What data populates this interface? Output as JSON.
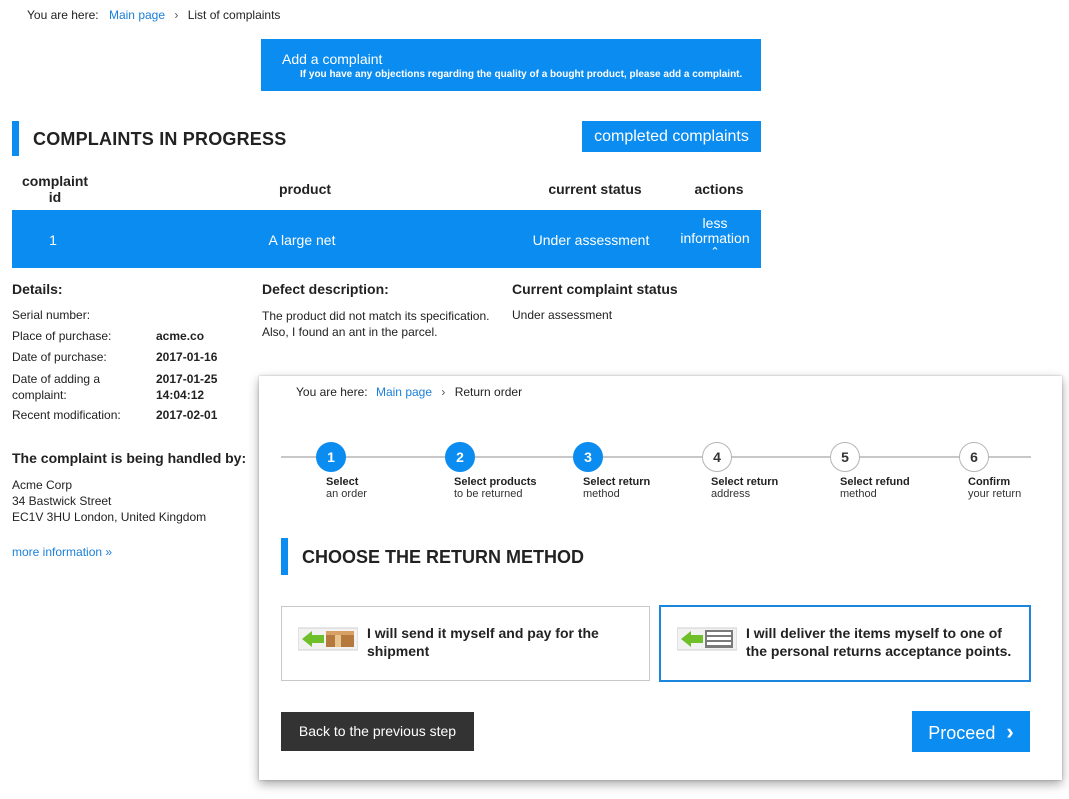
{
  "background": {
    "breadcrumb": {
      "prefix": "You are here:",
      "home": "Main page",
      "separator": "›",
      "current": "List of complaints"
    },
    "banner": {
      "title": "Add a complaint",
      "subtitle": "If you have any objections regarding the quality of a bought product, please add a complaint."
    },
    "section_title": "COMPLAINTS IN PROGRESS",
    "completed_button": "completed complaints",
    "table": {
      "headers": {
        "id_line1": "complaint",
        "id_line2": "id",
        "product": "product",
        "status": "current status",
        "actions": "actions"
      },
      "row": {
        "id": "1",
        "product": "A large net",
        "status": "Under assessment",
        "action_line1": "less",
        "action_line2": "information",
        "action_icon": "⌃"
      }
    },
    "details": {
      "heading": "Details:",
      "serial_label": "Serial number:",
      "place_label": "Place of purchase:",
      "place_value": "acme.co",
      "date_label": "Date of purchase:",
      "date_value": "2017-01-16",
      "added_label_line1": "Date of adding a",
      "added_label_line2": "complaint:",
      "added_value_line1": "2017-01-25",
      "added_value_line2": "14:04:12",
      "modified_label": "Recent modification:",
      "modified_value": "2017-02-01"
    },
    "defect": {
      "heading": "Defect description:",
      "line1": "The product did not match its specification.",
      "line2": "Also, I found an ant in the parcel."
    },
    "current_status": {
      "heading": "Current complaint status",
      "value": "Under assessment"
    },
    "handler": {
      "heading": "The complaint is being handled by:",
      "name": "Acme Corp",
      "street": "34 Bastwick Street",
      "city": "EC1V 3HU London, United Kingdom"
    },
    "more_info": "more information »"
  },
  "overlay": {
    "breadcrumb": {
      "prefix": "You are here:",
      "home": "Main page",
      "separator": "›",
      "current": "Return order"
    },
    "steps": [
      {
        "num": "1",
        "title": "Select",
        "sub": "an order",
        "active": true
      },
      {
        "num": "2",
        "title": "Select products",
        "sub": "to be returned",
        "active": true
      },
      {
        "num": "3",
        "title": "Select return",
        "sub": "method",
        "active": true
      },
      {
        "num": "4",
        "title": "Select return",
        "sub": "address",
        "active": false
      },
      {
        "num": "5",
        "title": "Select refund",
        "sub": "method",
        "active": false
      },
      {
        "num": "6",
        "title": "Confirm",
        "sub": "your return",
        "active": false
      }
    ],
    "title": "CHOOSE THE RETURN METHOD",
    "options": [
      {
        "icon": "package-ship-icon",
        "text": "I will send it myself and pay for the shipment",
        "selected": false
      },
      {
        "icon": "package-deliver-icon",
        "text": "I will deliver the items myself to one of the personal returns acceptance points.",
        "selected": true
      }
    ],
    "back_button": "Back to the previous step",
    "proceed_button": "Proceed",
    "proceed_icon": "›"
  },
  "colors": {
    "accent": "#0a8cf0",
    "dark_button": "#333333",
    "link": "#1a7fd9"
  }
}
